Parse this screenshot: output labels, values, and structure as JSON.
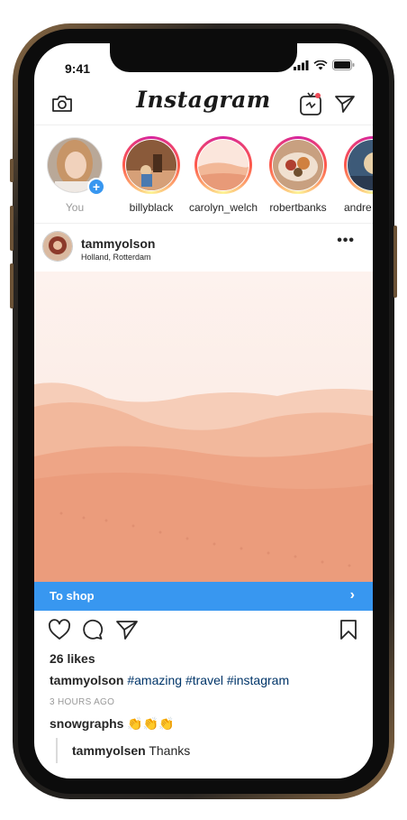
{
  "status": {
    "time": "9:41"
  },
  "header": {
    "logo": "Instagram",
    "camera_icon": "camera-icon",
    "igtv_icon": "igtv-icon",
    "direct_icon": "send-icon"
  },
  "stories": [
    {
      "label": "You"
    },
    {
      "label": "billyblack"
    },
    {
      "label": "carolyn_welch"
    },
    {
      "label": "robertbanks"
    },
    {
      "label": "andre"
    }
  ],
  "post": {
    "username": "tammyolson",
    "location": "Holland, Rotterdam",
    "more": "•••",
    "shop_label": "To shop",
    "shop_chevron": "›",
    "likes": "26 likes",
    "caption_user": "tammyolson",
    "caption_tags": "#amazing #travel #instagram",
    "time_ago": "3 HOURS AGO",
    "comment_user": "snowgraphs",
    "comment_text": "👏👏👏",
    "reply_user": "tammyolsen",
    "reply_text": "Thanks"
  },
  "colors": {
    "accent": "#3897f0",
    "text": "#262626",
    "hashtag": "#003569",
    "muted": "#999999"
  }
}
